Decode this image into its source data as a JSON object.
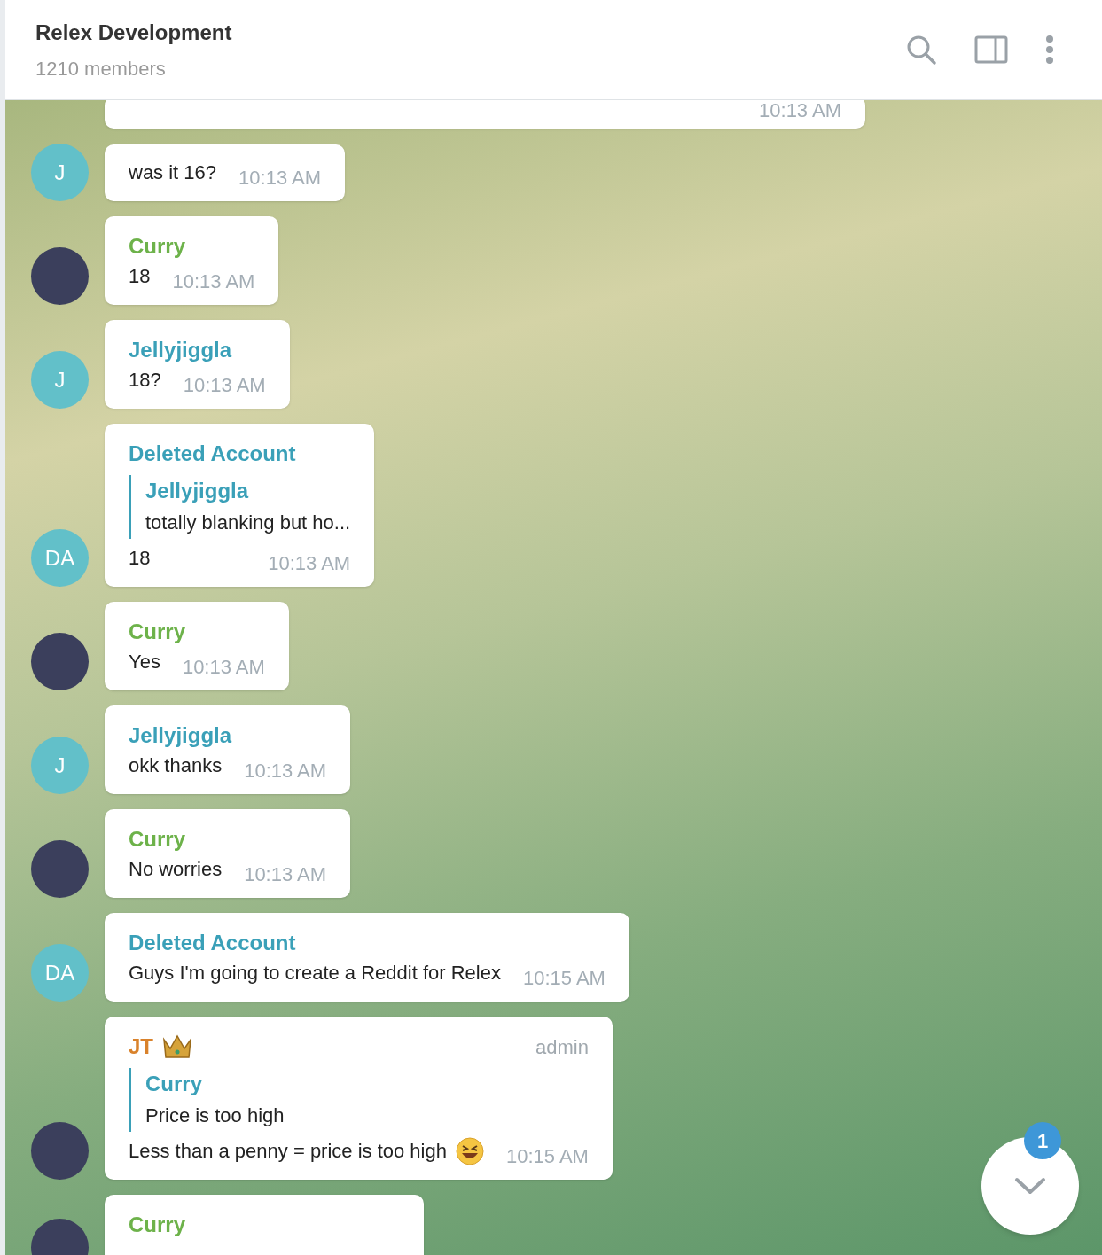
{
  "header": {
    "title": "Relex Development",
    "subtitle": "1210 members"
  },
  "messages": [
    {
      "time": "10:13 AM"
    },
    {
      "avatar": {
        "kind": "initials",
        "text": "J"
      },
      "text": "was it 16?",
      "time": "10:13 AM"
    },
    {
      "avatar": {
        "kind": "photo"
      },
      "sender": "Curry",
      "color": "#6db24a",
      "text": "18",
      "time": "10:13 AM"
    },
    {
      "avatar": {
        "kind": "initials",
        "text": "J"
      },
      "sender": "Jellyjiggla",
      "color": "#3aa0b8",
      "text": "18?",
      "time": "10:13 AM"
    },
    {
      "avatar": {
        "kind": "initials",
        "text": "DA"
      },
      "sender": "Deleted Account",
      "color": "#3aa0b8",
      "reply": {
        "name": "Jellyjiggla",
        "text": "totally blanking but ho..."
      },
      "text": "18",
      "time": "10:13 AM"
    },
    {
      "avatar": {
        "kind": "photo"
      },
      "sender": "Curry",
      "color": "#6db24a",
      "text": "Yes",
      "time": "10:13 AM"
    },
    {
      "avatar": {
        "kind": "initials",
        "text": "J"
      },
      "sender": "Jellyjiggla",
      "color": "#3aa0b8",
      "text": "okk thanks",
      "time": "10:13 AM"
    },
    {
      "avatar": {
        "kind": "photo"
      },
      "sender": "Curry",
      "color": "#6db24a",
      "text": "No worries",
      "time": "10:13 AM"
    },
    {
      "avatar": {
        "kind": "initials",
        "text": "DA"
      },
      "sender": "Deleted Account",
      "color": "#3aa0b8",
      "text": "Guys I'm going to create a Reddit for Relex",
      "time": "10:15 AM"
    },
    {
      "avatar": {
        "kind": "photo"
      },
      "sender": "JT",
      "color": "#d9822b",
      "crown": true,
      "role": "admin",
      "reply": {
        "name": "Curry",
        "text": "Price is too high"
      },
      "text": "Less than a penny = price is too high",
      "emoji": true,
      "time": "10:15 AM"
    },
    {
      "avatar": {
        "kind": "photo"
      },
      "sender": "Curry",
      "color": "#6db24a"
    }
  ],
  "scroll_button": {
    "badge": "1"
  }
}
